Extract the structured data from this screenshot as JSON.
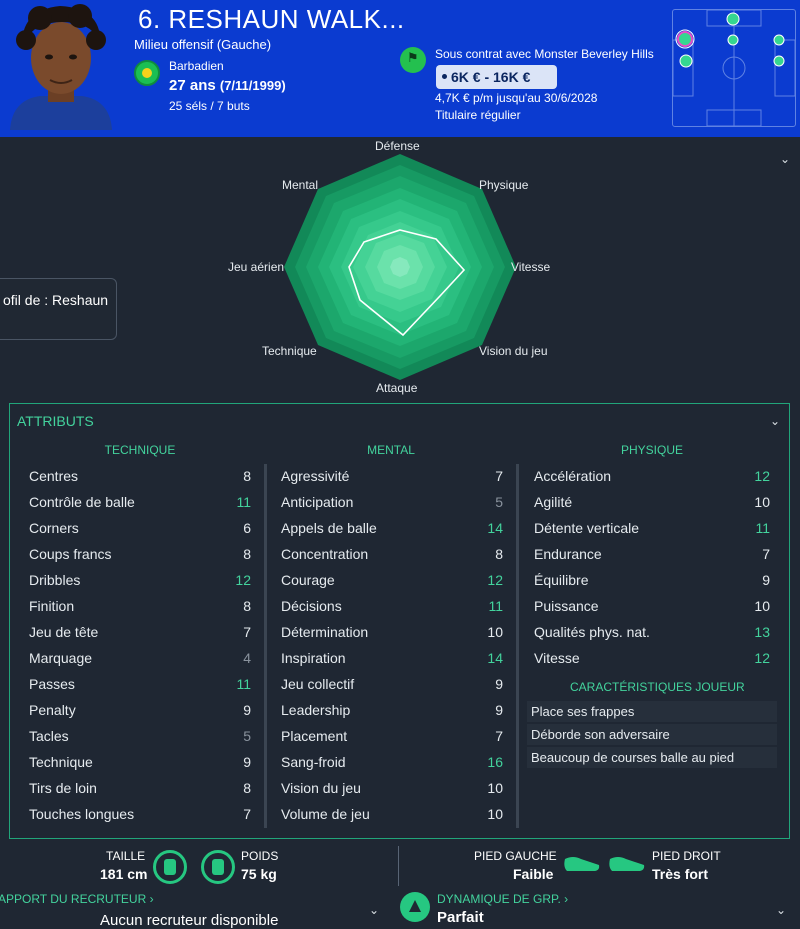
{
  "player": {
    "name": "6. RESHAUN WALK...",
    "position": "Milieu offensif (Gauche)",
    "nationality": "Barbadien",
    "age": "27 ans",
    "dob": "(7/11/1999)",
    "caps": "25 séls / 7 buts"
  },
  "contract": {
    "text": "Sous contrat avec Monster Beverley Hills",
    "wage_range": "6K € - 16K €",
    "wage_detail": "4,7K € p/m jusqu'au 30/6/2028",
    "status": "Titulaire régulier"
  },
  "profile_box": {
    "label": "ofil de : Reshaun"
  },
  "radar": {
    "labels": {
      "defense": "Défense",
      "physical": "Physique",
      "speed": "Vitesse",
      "vision": "Vision du jeu",
      "attack": "Attaque",
      "technique": "Technique",
      "aerial": "Jeu aérien",
      "mental": "Mental"
    }
  },
  "attributes": {
    "title": "ATTRIBUTS",
    "colors": {
      "high": "#43d39d",
      "normal": "#e6ebef",
      "low": "#8a939e"
    },
    "technique": {
      "title": "TECHNIQUE",
      "items": [
        {
          "label": "Centres",
          "value": "8",
          "tier": "normal"
        },
        {
          "label": "Contrôle de balle",
          "value": "11",
          "tier": "high"
        },
        {
          "label": "Corners",
          "value": "6",
          "tier": "normal"
        },
        {
          "label": "Coups francs",
          "value": "8",
          "tier": "normal"
        },
        {
          "label": "Dribbles",
          "value": "12",
          "tier": "high"
        },
        {
          "label": "Finition",
          "value": "8",
          "tier": "normal"
        },
        {
          "label": "Jeu de tête",
          "value": "7",
          "tier": "normal"
        },
        {
          "label": "Marquage",
          "value": "4",
          "tier": "low"
        },
        {
          "label": "Passes",
          "value": "11",
          "tier": "high"
        },
        {
          "label": "Penalty",
          "value": "9",
          "tier": "normal"
        },
        {
          "label": "Tacles",
          "value": "5",
          "tier": "low"
        },
        {
          "label": "Technique",
          "value": "9",
          "tier": "normal"
        },
        {
          "label": "Tirs de loin",
          "value": "8",
          "tier": "normal"
        },
        {
          "label": "Touches longues",
          "value": "7",
          "tier": "normal"
        }
      ]
    },
    "mental": {
      "title": "MENTAL",
      "items": [
        {
          "label": "Agressivité",
          "value": "7",
          "tier": "normal"
        },
        {
          "label": "Anticipation",
          "value": "5",
          "tier": "low"
        },
        {
          "label": "Appels de balle",
          "value": "14",
          "tier": "high"
        },
        {
          "label": "Concentration",
          "value": "8",
          "tier": "normal"
        },
        {
          "label": "Courage",
          "value": "12",
          "tier": "high"
        },
        {
          "label": "Décisions",
          "value": "11",
          "tier": "high"
        },
        {
          "label": "Détermination",
          "value": "10",
          "tier": "normal"
        },
        {
          "label": "Inspiration",
          "value": "14",
          "tier": "high"
        },
        {
          "label": "Jeu collectif",
          "value": "9",
          "tier": "normal"
        },
        {
          "label": "Leadership",
          "value": "9",
          "tier": "normal"
        },
        {
          "label": "Placement",
          "value": "7",
          "tier": "normal"
        },
        {
          "label": "Sang-froid",
          "value": "16",
          "tier": "high"
        },
        {
          "label": "Vision du jeu",
          "value": "10",
          "tier": "normal"
        },
        {
          "label": "Volume de jeu",
          "value": "10",
          "tier": "normal"
        }
      ]
    },
    "physique": {
      "title": "PHYSIQUE",
      "items": [
        {
          "label": "Accélération",
          "value": "12",
          "tier": "high"
        },
        {
          "label": "Agilité",
          "value": "10",
          "tier": "normal"
        },
        {
          "label": "Détente verticale",
          "value": "11",
          "tier": "high"
        },
        {
          "label": "Endurance",
          "value": "7",
          "tier": "normal"
        },
        {
          "label": "Équilibre",
          "value": "9",
          "tier": "normal"
        },
        {
          "label": "Puissance",
          "value": "10",
          "tier": "normal"
        },
        {
          "label": "Qualités phys. nat.",
          "value": "13",
          "tier": "high"
        },
        {
          "label": "Vitesse",
          "value": "12",
          "tier": "high"
        }
      ]
    },
    "traits": {
      "title": "CARACTÉRISTIQUES JOUEUR",
      "items": [
        "Place ses frappes",
        "Déborde son adversaire",
        "Beaucoup de courses balle au pied"
      ]
    }
  },
  "footer": {
    "height_label": "TAILLE",
    "height_value": "181 cm",
    "weight_label": "POIDS",
    "weight_value": "75 kg",
    "left_foot_label": "PIED GAUCHE",
    "left_foot_value": "Faible",
    "right_foot_label": "PIED DROIT",
    "right_foot_value": "Très fort",
    "scout_title": "APPORT DU RECRUTEUR ›",
    "scout_text": "Aucun recruteur disponible",
    "dynamics_title": "DYNAMIQUE DE GRP. ›",
    "dynamics_value": "Parfait"
  }
}
